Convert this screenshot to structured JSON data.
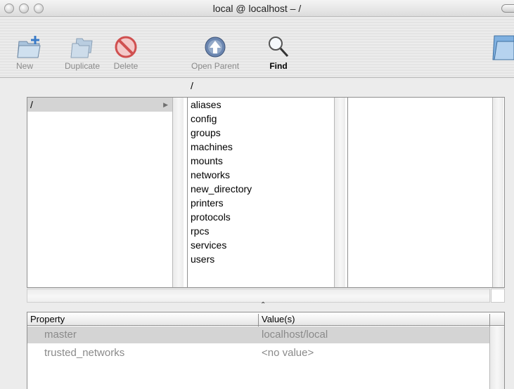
{
  "window": {
    "title": "local @ localhost – /"
  },
  "toolbar": {
    "new_label": "New",
    "duplicate_label": "Duplicate",
    "delete_label": "Delete",
    "open_parent_label": "Open Parent",
    "find_label": "Find"
  },
  "path": "/",
  "browser": {
    "column1": [
      {
        "label": "/"
      }
    ],
    "column2": [
      {
        "label": "aliases"
      },
      {
        "label": "config"
      },
      {
        "label": "groups"
      },
      {
        "label": "machines"
      },
      {
        "label": "mounts"
      },
      {
        "label": "networks"
      },
      {
        "label": "new_directory"
      },
      {
        "label": "printers"
      },
      {
        "label": "protocols"
      },
      {
        "label": "rpcs"
      },
      {
        "label": "services"
      },
      {
        "label": "users"
      }
    ]
  },
  "properties": {
    "header_property": "Property",
    "header_values": "Value(s)",
    "rows": [
      {
        "key": "master",
        "value": "localhost/local"
      },
      {
        "key": "trusted_networks",
        "value": "<no value>"
      }
    ]
  },
  "colors": {
    "selection": "#d4d4d4",
    "window_bg": "#ececec",
    "disabled_text": "#8a8a8a"
  }
}
